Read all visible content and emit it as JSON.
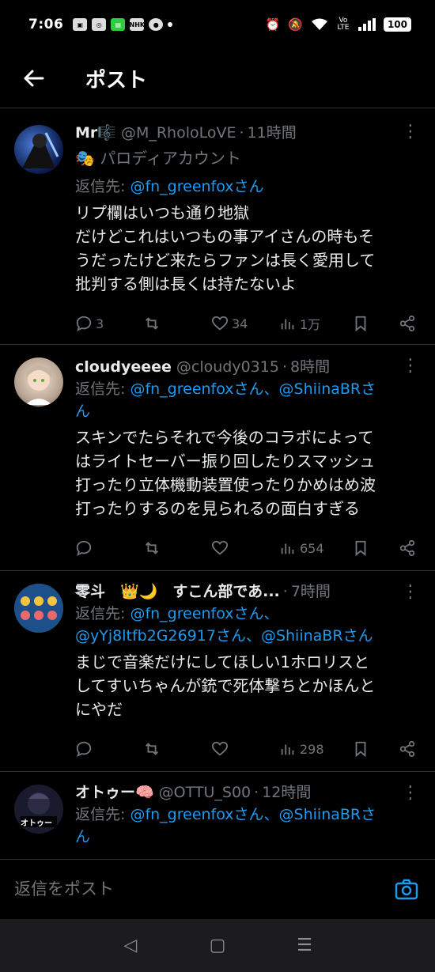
{
  "status": {
    "time": "7:06",
    "battery": "100",
    "volte": "Vo LTE",
    "nhk": "NHK"
  },
  "header": {
    "title": "ポスト"
  },
  "tweets": [
    {
      "name": "Mr🎼",
      "handle": "@M_RholoLoVE",
      "time": "11時間",
      "parody": "🎭 パロディアカウント",
      "reply_prefix": "返信先: ",
      "mentions": "@fn_greenfoxさん",
      "text": [
        "リプ欄はいつも通り地獄",
        "だけどこれはいつもの事アイさんの時もそ",
        "うだったけど来たらファンは長く愛用して",
        "批判する側は長くは持たないよ"
      ],
      "replies": "3",
      "retweets": "",
      "likes": "34",
      "views": "1万"
    },
    {
      "name": "cloudyeeee",
      "handle": "@cloudy0315",
      "time": "8時間",
      "reply_prefix": "返信先: ",
      "mentions": "@fn_greenfoxさん、@ShiinaBRさ",
      "mentions2": "ん",
      "text": [
        "スキンでたらそれで今後のコラボによって",
        "はライトセーバー振り回したりスマッシュ",
        "打ったり立体機動装置使ったりかめはめ波",
        "打ったりするのを見られるの面白すぎる"
      ],
      "replies": "",
      "retweets": "",
      "likes": "",
      "views": "654"
    },
    {
      "name": "零斗　👑🌙　すこん部であ...",
      "handle": "",
      "time": "7時間",
      "reply_prefix": "返信先: ",
      "mentions": "@fn_greenfoxさん、",
      "mentions2": "@yYj8ltfb2G26917さん、@ShiinaBRさん",
      "text": [
        "まじで音楽だけにしてほしい1ホロリスと",
        "してすいちゃんが銃で死体撃ちとかほんと",
        "にやだ"
      ],
      "replies": "",
      "retweets": "",
      "likes": "",
      "views": "298"
    },
    {
      "name": "オトゥー🧠",
      "handle": "@OTTU_S00",
      "time": "12時間",
      "reply_prefix": "返信先: ",
      "mentions": "@fn_greenfoxさん、@ShiinaBRさ",
      "mentions2": "ん"
    }
  ],
  "avatar_labels": {
    "otto": "オトゥー"
  },
  "composer": {
    "placeholder": "返信をポスト"
  },
  "nav": {
    "back": "◁",
    "home": "▢",
    "recents": "☰"
  },
  "colors": {
    "accent": "#1d9bf0",
    "muted": "#71767b",
    "divider": "#2f3336"
  }
}
